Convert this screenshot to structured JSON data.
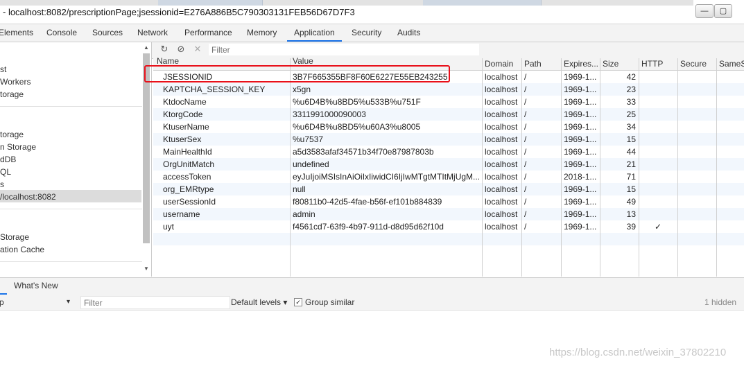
{
  "window": {
    "title": "- localhost:8082/prescriptionPage;jsessionid=E276A886B5C790303131FEB56D67D7F3",
    "minimize_glyph": "—",
    "maximize_glyph": "▢"
  },
  "devtools_tabs": [
    "Elements",
    "Console",
    "Sources",
    "Network",
    "Performance",
    "Memory",
    "Application",
    "Security",
    "Audits"
  ],
  "active_tab": "Application",
  "sidebar": {
    "items": [
      "st",
      " Workers",
      "torage",
      "torage",
      "n Storage",
      "dDB",
      "QL",
      "s",
      "/localhost:8082",
      "Storage",
      "ation Cache"
    ],
    "selected": "/localhost:8082"
  },
  "toolbar": {
    "refresh_icon": "refresh-icon",
    "clear_icon": "clear-all-icon",
    "delete_icon": "delete-icon",
    "filter_placeholder": "Filter"
  },
  "cookies": {
    "columns": [
      "Name",
      "Value",
      "Domain",
      "Path",
      "Expires...",
      "Size",
      "HTTP",
      "Secure",
      "SameS"
    ],
    "rows": [
      {
        "name": "JSESSIONID",
        "value": "3B7F665355BF8F60E6227E55EB243255",
        "domain": "localhost",
        "path": "/",
        "expires": "1969-1...",
        "size": "42",
        "http": "",
        "secure": ""
      },
      {
        "name": "KAPTCHA_SESSION_KEY",
        "value": "x5gn",
        "domain": "localhost",
        "path": "/",
        "expires": "1969-1...",
        "size": "23",
        "http": "",
        "secure": ""
      },
      {
        "name": "KtdocName",
        "value": "%u6D4B%u8BD5%u533B%u751F",
        "domain": "localhost",
        "path": "/",
        "expires": "1969-1...",
        "size": "33",
        "http": "",
        "secure": ""
      },
      {
        "name": "KtorgCode",
        "value": "3311991000090003",
        "domain": "localhost",
        "path": "/",
        "expires": "1969-1...",
        "size": "25",
        "http": "",
        "secure": ""
      },
      {
        "name": "KtuserName",
        "value": "%u6D4B%u8BD5%u60A3%u8005",
        "domain": "localhost",
        "path": "/",
        "expires": "1969-1...",
        "size": "34",
        "http": "",
        "secure": ""
      },
      {
        "name": "KtuserSex",
        "value": "%u7537",
        "domain": "localhost",
        "path": "/",
        "expires": "1969-1...",
        "size": "15",
        "http": "",
        "secure": ""
      },
      {
        "name": "MainHealthId",
        "value": "a5d3583afaf34571b34f70e87987803b",
        "domain": "localhost",
        "path": "/",
        "expires": "1969-1...",
        "size": "44",
        "http": "",
        "secure": ""
      },
      {
        "name": "OrgUnitMatch",
        "value": "undefined",
        "domain": "localhost",
        "path": "/",
        "expires": "1969-1...",
        "size": "21",
        "http": "",
        "secure": ""
      },
      {
        "name": "accessToken",
        "value": "eyJuIjoiMSIsInAiOiIxIiwidCI6IjIwMTgtMTItMjUgM...",
        "domain": "localhost",
        "path": "/",
        "expires": "2018-1...",
        "size": "71",
        "http": "",
        "secure": ""
      },
      {
        "name": "org_EMRtype",
        "value": "null",
        "domain": "localhost",
        "path": "/",
        "expires": "1969-1...",
        "size": "15",
        "http": "",
        "secure": ""
      },
      {
        "name": "userSessionId",
        "value": "f80811b0-42d5-4fae-b56f-ef101b884839",
        "domain": "localhost",
        "path": "/",
        "expires": "1969-1...",
        "size": "49",
        "http": "",
        "secure": ""
      },
      {
        "name": "username",
        "value": "admin",
        "domain": "localhost",
        "path": "/",
        "expires": "1969-1...",
        "size": "13",
        "http": "",
        "secure": ""
      },
      {
        "name": "uyt",
        "value": "f4561cd7-63f9-4b97-911d-d8d95d62f10d",
        "domain": "localhost",
        "path": "/",
        "expires": "1969-1...",
        "size": "39",
        "http": "✓",
        "secure": ""
      }
    ]
  },
  "drawer": {
    "whats_new": "What's New",
    "context": "p",
    "filter_placeholder": "Filter",
    "levels": "Default levels ▾",
    "group_similar": "Group similar",
    "hidden_count": "1 hidden",
    "dropdown_glyph": "▾"
  },
  "watermark": "https://blog.csdn.net/weixin_37802210",
  "colors": {
    "accent": "#1a73e8",
    "highlight": "#e8101a",
    "alt_row": "#f2f7fd"
  }
}
